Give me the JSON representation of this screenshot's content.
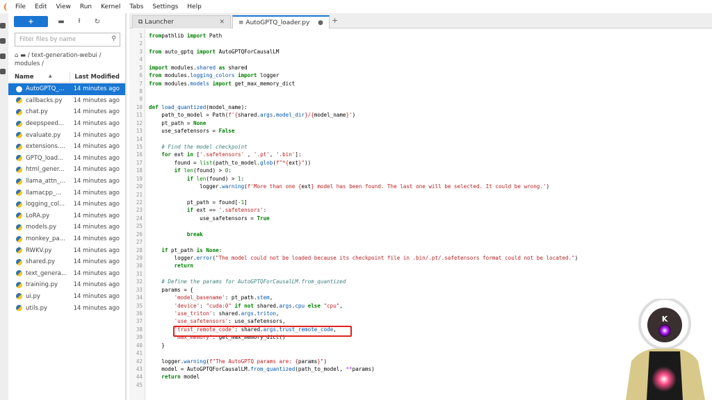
{
  "menu": [
    "File",
    "Edit",
    "View",
    "Run",
    "Kernel",
    "Tabs",
    "Settings",
    "Help"
  ],
  "filebrowser": {
    "new_label": "+",
    "filter_placeholder": "Filter files by name",
    "breadcrumb": "/ text-generation-webui / modules /",
    "col_name": "Name",
    "col_modified": "Last Modified",
    "files": [
      {
        "name": "AutoGPTQ_...",
        "modified": "14 minutes ago"
      },
      {
        "name": "callbacks.py",
        "modified": "14 minutes ago"
      },
      {
        "name": "chat.py",
        "modified": "14 minutes ago"
      },
      {
        "name": "deepspeed...",
        "modified": "14 minutes ago"
      },
      {
        "name": "evaluate.py",
        "modified": "14 minutes ago"
      },
      {
        "name": "extensions....",
        "modified": "14 minutes ago"
      },
      {
        "name": "GPTQ_load...",
        "modified": "14 minutes ago"
      },
      {
        "name": "html_gener...",
        "modified": "14 minutes ago"
      },
      {
        "name": "llama_attn_...",
        "modified": "14 minutes ago"
      },
      {
        "name": "llamacpp_...",
        "modified": "14 minutes ago"
      },
      {
        "name": "logging_col...",
        "modified": "14 minutes ago"
      },
      {
        "name": "LoRA.py",
        "modified": "14 minutes ago"
      },
      {
        "name": "models.py",
        "modified": "14 minutes ago"
      },
      {
        "name": "monkey_pa...",
        "modified": "14 minutes ago"
      },
      {
        "name": "RWKV.py",
        "modified": "14 minutes ago"
      },
      {
        "name": "shared.py",
        "modified": "14 minutes ago"
      },
      {
        "name": "text_genera...",
        "modified": "14 minutes ago"
      },
      {
        "name": "training.py",
        "modified": "14 minutes ago"
      },
      {
        "name": "ui.py",
        "modified": "14 minutes ago"
      },
      {
        "name": "utils.py",
        "modified": "14 minutes ago"
      }
    ]
  },
  "tabs": [
    {
      "label": "Launcher",
      "close": "✕"
    },
    {
      "label": "AutoGPTQ_loader.py",
      "close": "●"
    }
  ],
  "tab_add": "+",
  "avatar_letter": "K",
  "highlight_line": 38,
  "code": [
    [
      [
        "kw",
        "from"
      ],
      [
        "",
        "pathlib "
      ],
      [
        "kw",
        "import"
      ],
      [
        "",
        " Path"
      ]
    ],
    [],
    [
      [
        "kw",
        "from"
      ],
      [
        "",
        " auto_gptq "
      ],
      [
        "kw",
        "import"
      ],
      [
        "",
        " AutoGPTQForCausalLM"
      ]
    ],
    [],
    [
      [
        "kw",
        "import"
      ],
      [
        "",
        " modules."
      ],
      [
        "at",
        "shared"
      ],
      [
        " ",
        ""
      ],
      [
        "kw",
        " as"
      ],
      [
        "",
        " shared"
      ]
    ],
    [
      [
        "kw",
        "from"
      ],
      [
        "",
        " modules."
      ],
      [
        "at",
        "logging_colors"
      ],
      [
        "kw",
        " import"
      ],
      [
        "",
        " logger"
      ]
    ],
    [
      [
        "kw",
        "from"
      ],
      [
        "",
        " modules."
      ],
      [
        "at",
        "models"
      ],
      [
        "kw",
        " import"
      ],
      [
        "",
        " get_max_memory_dict"
      ]
    ],
    [],
    [],
    [
      [
        "kw",
        "def"
      ],
      [
        "at",
        " load_quantized"
      ],
      [
        "",
        "(model_name):"
      ]
    ],
    [
      [
        "",
        "    path_to_model = Path("
      ],
      [
        "str",
        "f'{"
      ],
      [
        "",
        "shared."
      ],
      [
        "at",
        "args"
      ],
      [
        "",
        "."
      ],
      [
        "at",
        "model_dir"
      ],
      [
        "str",
        "}/{"
      ],
      [
        "",
        "model_name"
      ],
      [
        "str",
        "}'"
      ],
      [
        "",
        ")"
      ]
    ],
    [
      [
        "",
        "    pt_path = "
      ],
      [
        "kw",
        "None"
      ]
    ],
    [
      [
        "",
        "    use_safetensors = "
      ],
      [
        "kw",
        "False"
      ]
    ],
    [],
    [
      [
        "cm",
        "    # Find the model checkpoint"
      ]
    ],
    [
      [
        "kw",
        "    for"
      ],
      [
        "",
        " ext "
      ],
      [
        "kw",
        "in"
      ],
      [
        "",
        " ["
      ],
      [
        "str",
        "'.safetensors'"
      ],
      [
        "",
        " , "
      ],
      [
        "str",
        "'.pt'"
      ],
      [
        "",
        ", "
      ],
      [
        "str",
        "'.bin'"
      ],
      [
        "",
        "]:"
      ]
    ],
    [
      [
        "",
        "        found = "
      ],
      [
        "bi",
        "list"
      ],
      [
        "",
        "(path_to_model."
      ],
      [
        "at",
        "glob"
      ],
      [
        "",
        "("
      ],
      [
        "str",
        "f\"*{"
      ],
      [
        "",
        "ext"
      ],
      [
        "str",
        "}\""
      ],
      [
        "",
        "))"
      ]
    ],
    [
      [
        "kw",
        "        if"
      ],
      [
        "bi",
        " len"
      ],
      [
        "",
        "(found) > "
      ],
      [
        "num",
        "0"
      ],
      [
        "",
        ":"
      ]
    ],
    [
      [
        "kw",
        "            if"
      ],
      [
        "bi",
        " len"
      ],
      [
        "",
        "(found) > "
      ],
      [
        "num",
        "1"
      ],
      [
        "",
        ":"
      ]
    ],
    [
      [
        "",
        "                logger."
      ],
      [
        "at",
        "warning"
      ],
      [
        "",
        "("
      ],
      [
        "str",
        "f'More than one {"
      ],
      [
        "",
        "ext"
      ],
      [
        "str",
        "} model has been found. The last one will be selected. It could be wrong.'"
      ],
      [
        "",
        ")"
      ]
    ],
    [],
    [
      [
        "",
        "            pt_path = found["
      ],
      [
        "num",
        "-1"
      ],
      [
        "",
        "]"
      ]
    ],
    [
      [
        "kw",
        "            if"
      ],
      [
        "",
        " ext == "
      ],
      [
        "str",
        "'.safetensors'"
      ],
      [
        "",
        ":"
      ]
    ],
    [
      [
        "",
        "                use_safetensors = "
      ],
      [
        "kw",
        "True"
      ]
    ],
    [],
    [
      [
        "kw",
        "            break"
      ]
    ],
    [],
    [
      [
        "kw",
        "    if"
      ],
      [
        "",
        " pt_path "
      ],
      [
        "kw",
        "is"
      ],
      [
        "kw",
        " None"
      ],
      [
        "",
        ":"
      ]
    ],
    [
      [
        "",
        "        logger."
      ],
      [
        "at",
        "error"
      ],
      [
        "",
        "("
      ],
      [
        "str",
        "\"The model could not be loaded because its checkpoint file in .bin/.pt/.safetensors format could not be located.\""
      ],
      [
        "",
        ")"
      ]
    ],
    [
      [
        "kw",
        "        return"
      ]
    ],
    [],
    [
      [
        "cm",
        "    # Define the params for AutoGPTQForCausalLM.from_quantized"
      ]
    ],
    [
      [
        "",
        "    params = {"
      ]
    ],
    [
      [
        "str",
        "        'model_basename'"
      ],
      [
        "",
        ": pt_path."
      ],
      [
        "at",
        "stem"
      ],
      [
        "",
        ","
      ]
    ],
    [
      [
        "str",
        "        'device'"
      ],
      [
        "",
        ": "
      ],
      [
        "str",
        "\"cuda:0\""
      ],
      [
        "kw",
        " if"
      ],
      [
        "kw",
        " not"
      ],
      [
        "",
        " shared."
      ],
      [
        "at",
        "args"
      ],
      [
        "",
        "."
      ],
      [
        "at",
        "cpu"
      ],
      [
        "kw",
        " else"
      ],
      [
        "str",
        " \"cpu\""
      ],
      [
        "",
        ","
      ]
    ],
    [
      [
        "str",
        "        'use_triton'"
      ],
      [
        "",
        ": shared."
      ],
      [
        "at",
        "args"
      ],
      [
        "",
        "."
      ],
      [
        "at",
        "triton"
      ],
      [
        "",
        ","
      ]
    ],
    [
      [
        "str",
        "        'use_safetensors'"
      ],
      [
        "",
        ": use_safetensors,"
      ]
    ],
    [
      [
        "str",
        "        'trust_remote_code'"
      ],
      [
        "",
        ": shared."
      ],
      [
        "at",
        "args"
      ],
      [
        "",
        "."
      ],
      [
        "at",
        "trust_remote_code"
      ],
      [
        "",
        ","
      ]
    ],
    [
      [
        "str",
        "        'max_memory'"
      ],
      [
        "",
        ": get_max_memory_dict()"
      ]
    ],
    [
      [
        "",
        "    }"
      ]
    ],
    [],
    [
      [
        "",
        "    logger."
      ],
      [
        "at",
        "warning"
      ],
      [
        "",
        "("
      ],
      [
        "str",
        "f\"The AutoGPTQ params are: {"
      ],
      [
        "",
        "params"
      ],
      [
        "str",
        "}\""
      ],
      [
        "",
        ")"
      ]
    ],
    [
      [
        "",
        "    model = AutoGPTQForCausalLM."
      ],
      [
        "at",
        "from_quantized"
      ],
      [
        "",
        "(path_to_model, "
      ],
      [
        "op",
        "**"
      ],
      [
        "",
        "params)"
      ]
    ],
    [
      [
        "kw",
        "    return"
      ],
      [
        "",
        " model"
      ]
    ],
    []
  ]
}
